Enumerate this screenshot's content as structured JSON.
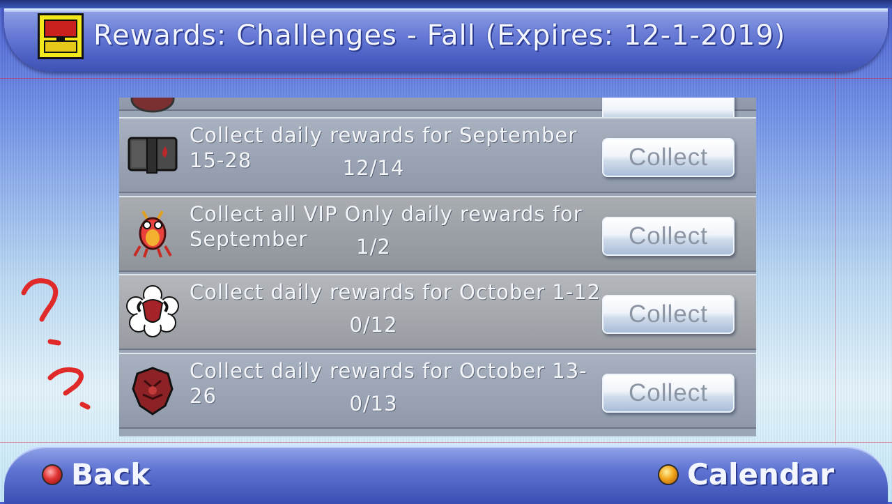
{
  "header": {
    "title": "Rewards: Challenges - Fall (Expires: 12-1-2019)",
    "icon": "treasure-chest-icon"
  },
  "challenges": [
    {
      "icon": "book-icon",
      "text": "Collect daily rewards for September\n15-28",
      "progress": "12/14",
      "button": "Collect"
    },
    {
      "icon": "crab-monster-icon",
      "text": "Collect all VIP Only daily rewards for\nSeptember",
      "progress": "1/2",
      "button": "Collect"
    },
    {
      "icon": "ram-skull-icon",
      "text": "Collect daily rewards for October 1-12",
      "progress": "0/12",
      "button": "Collect"
    },
    {
      "icon": "demon-shield-icon",
      "text": "Collect daily rewards for October 13-26",
      "progress": "0/13",
      "button": "Collect"
    }
  ],
  "footer": {
    "back_label": "Back",
    "calendar_label": "Calendar"
  },
  "annotations": [
    "?",
    "?"
  ],
  "colors": {
    "accent": "#4a5ccf",
    "back_button": "#e23434",
    "calendar_button": "#f2a51a"
  }
}
